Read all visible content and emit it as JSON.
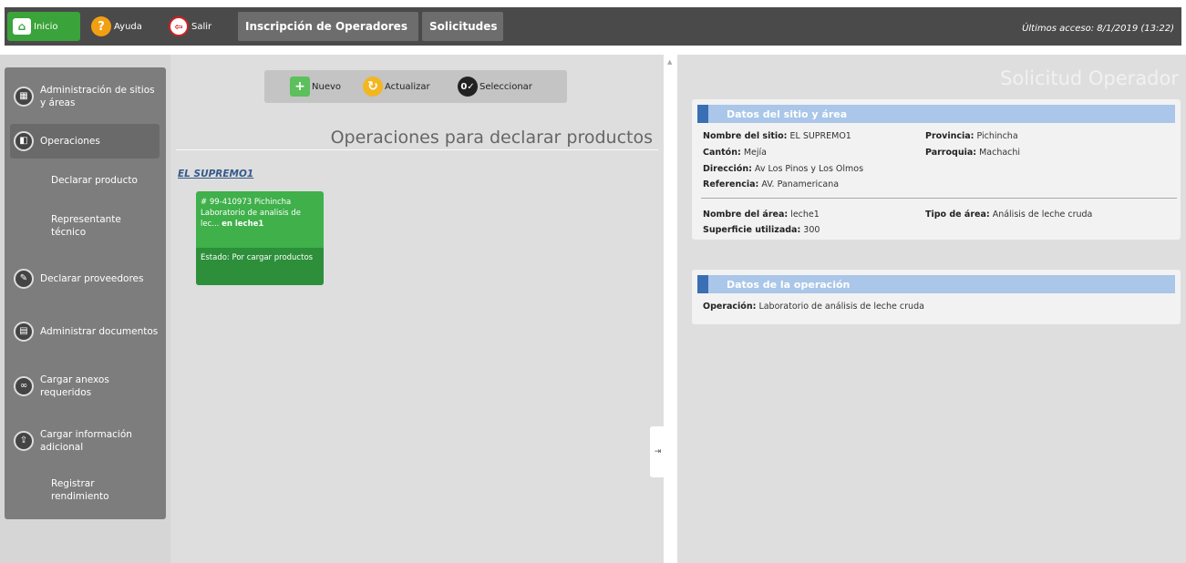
{
  "topbar": {
    "home": "Inicio",
    "help": "Ayuda",
    "exit": "Salir",
    "menu_inscripcion": "Inscripción de Operadores",
    "menu_solicitudes": "Solicitudes",
    "last_access": "Últimos acceso: 8/1/2019 (13:22)"
  },
  "sidebar": {
    "items": [
      {
        "label": "Administración de sitios y áreas"
      },
      {
        "label": "Operaciones"
      },
      {
        "label": "Declarar producto"
      },
      {
        "label": "Representante técnico"
      },
      {
        "label": "Declarar proveedores"
      },
      {
        "label": "Administrar documentos"
      },
      {
        "label": "Cargar anexos requeridos"
      },
      {
        "label": "Cargar información adicional"
      },
      {
        "label": "Registrar rendimiento"
      }
    ]
  },
  "toolbar": {
    "new": "Nuevo",
    "update": "Actualizar",
    "select": "Seleccionar"
  },
  "middle": {
    "title": "Operaciones para declarar productos",
    "site": "EL SUPREMO1",
    "card": {
      "line1": "# 99-410973 Pichincha",
      "line2": "Laboratorio de analisis de",
      "line3_pre": "lec...",
      "line3_bold": "en leche1",
      "status": "Estado: Por cargar productos"
    }
  },
  "right": {
    "title": "Solicitud Operador",
    "site_box": {
      "header": "Datos del sitio y área",
      "nombre_sitio_label": "Nombre del sitio:",
      "nombre_sitio": "EL SUPREMO1",
      "provincia_label": "Provincia:",
      "provincia": "Pichincha",
      "canton_label": "Cantón:",
      "canton": "Mejía",
      "parroquia_label": "Parroquia:",
      "parroquia": "Machachi",
      "direccion_label": "Dirección:",
      "direccion": "Av Los Pinos y Los Olmos",
      "referencia_label": "Referencia:",
      "referencia": "AV. Panamericana",
      "nombre_area_label": "Nombre del área:",
      "nombre_area": "leche1",
      "tipo_area_label": "Tipo de área:",
      "tipo_area": "Análisis de leche cruda",
      "superficie_label": "Superficie utilizada:",
      "superficie": "300"
    },
    "op_box": {
      "header": "Datos de la operación",
      "operacion_label": "Operación:",
      "operacion": "Laboratorio de análisis de leche cruda"
    }
  }
}
